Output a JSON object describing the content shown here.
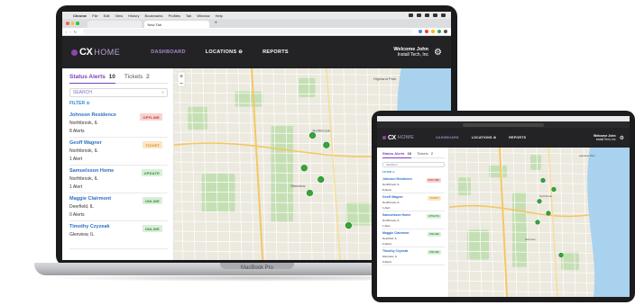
{
  "colors": {
    "offline": "#f6d3d3",
    "offline_text": "#c0392b",
    "ticket": "#fbe6c6",
    "ticket_text": "#d08a1c",
    "update": "#d8efd7",
    "update_text": "#2e8b3a",
    "online": "#d8efd7",
    "online_text": "#2e8b3a",
    "accent": "#7d3fb8"
  },
  "laptop": {
    "model_label": "MacBook Pro",
    "menubar": {
      "items": [
        "Chrome",
        "File",
        "Edit",
        "View",
        "History",
        "Bookmarks",
        "Profiles",
        "Tab",
        "Window",
        "Help"
      ]
    },
    "browser": {
      "active_tab": "New Tab",
      "new_tab_symbol": "+"
    },
    "app": {
      "logo_cx": "CX",
      "logo_home": "HOME",
      "nav": [
        "DASHBOARD",
        "LOCATIONS ⊖",
        "REPORTS"
      ],
      "welcome_line1": "Welcome John",
      "welcome_line2": "Install Tech, Inc",
      "tabs": [
        {
          "label": "Status Alerts",
          "count": "10"
        },
        {
          "label": "Tickets",
          "count": "2"
        }
      ],
      "search_placeholder": "SEARCH",
      "filter_label": "FILTER ⊙",
      "locations": [
        {
          "name": "Johnson Residence",
          "city": "Northbrook, IL",
          "alerts": "8 Alerts",
          "status": "OFFLINE",
          "kind": "offline"
        },
        {
          "name": "Geoff Wagner",
          "city": "Northbrook, IL",
          "alerts": "1 Alert",
          "status": "TICKET",
          "kind": "ticket"
        },
        {
          "name": "Samuelsson Home",
          "city": "Northbrook, IL",
          "alerts": "1 Alert",
          "status": "UPDATE",
          "kind": "update"
        },
        {
          "name": "Maggie Clairmont",
          "city": "Deerfield, IL",
          "alerts": "0 Alerts",
          "status": "ONLINE",
          "kind": "online"
        },
        {
          "name": "Timothy Czyzeak",
          "city": "Glenview, IL",
          "alerts": "",
          "status": "ONLINE",
          "kind": "online"
        }
      ]
    }
  },
  "tablet": {
    "app": {
      "logo_cx": "CX",
      "logo_home": "HOME",
      "nav": [
        "DASHBOARD",
        "LOCATIONS ⊖",
        "REPORTS"
      ],
      "welcome_line1": "Welcome John",
      "welcome_line2": "Install Tech, Inc",
      "tabs": [
        {
          "label": "Status Alerts",
          "count": "10"
        },
        {
          "label": "Tickets",
          "count": "2"
        }
      ],
      "search_placeholder": "SEARCH",
      "filter_label": "FILTER ⊙",
      "locations": [
        {
          "name": "Johnson Residence",
          "city": "Northbrook, IL",
          "alerts": "8 Alerts",
          "status": "OFFLINE",
          "kind": "offline"
        },
        {
          "name": "Geoff Wagner",
          "city": "Northbrook, IL",
          "alerts": "1 Alert",
          "status": "TICKET",
          "kind": "ticket"
        },
        {
          "name": "Samuelsson Home",
          "city": "Northbrook, IL",
          "alerts": "1 Alert",
          "status": "UPDATE",
          "kind": "update"
        },
        {
          "name": "Maggie Clairmont",
          "city": "Deerfield, IL",
          "alerts": "0 Alerts",
          "status": "ONLINE",
          "kind": "online"
        },
        {
          "name": "Timothy Czyzeak",
          "city": "Glenview, IL",
          "alerts": "0 Alerts",
          "status": "ONLINE",
          "kind": "online"
        }
      ]
    }
  },
  "map": {
    "marker_color": "#2fa836",
    "zoom_in": "+",
    "zoom_out": "−",
    "labels": [
      "Highland Park",
      "Northbrook",
      "Glenview"
    ]
  }
}
